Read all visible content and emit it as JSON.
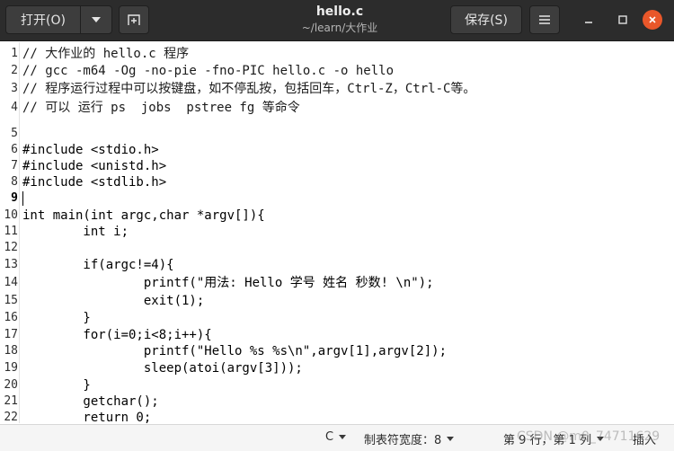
{
  "header": {
    "open_label": "打开(O)",
    "save_label": "保存(S)",
    "title": "hello.c",
    "subtitle": "~/learn/大作业"
  },
  "editor": {
    "current_line": 9,
    "lines": [
      {
        "n": "1",
        "text": "// 大作业的 hello.c 程序"
      },
      {
        "n": "2",
        "text": "// gcc -m64 -Og -no-pie -fno-PIC hello.c -o hello"
      },
      {
        "n": "3",
        "text": "// 程序运行过程中可以按键盘，如不停乱按，包括回车，Ctrl-Z，Ctrl-C等。"
      },
      {
        "n": "4",
        "text": "// 可以 运行 ps  jobs  pstree fg 等命令"
      },
      {
        "n": "5",
        "text": ""
      },
      {
        "n": "6",
        "text": "#include <stdio.h>"
      },
      {
        "n": "7",
        "text": "#include <unistd.h>"
      },
      {
        "n": "8",
        "text": "#include <stdlib.h>"
      },
      {
        "n": "9",
        "text": ""
      },
      {
        "n": "10",
        "text": "int main(int argc,char *argv[]){"
      },
      {
        "n": "11",
        "text": "        int i;"
      },
      {
        "n": "12",
        "text": ""
      },
      {
        "n": "13",
        "text": "        if(argc!=4){"
      },
      {
        "n": "14",
        "text": "                printf(\"用法: Hello 学号 姓名 秒数! \\n\");"
      },
      {
        "n": "15",
        "text": "                exit(1);"
      },
      {
        "n": "16",
        "text": "        }"
      },
      {
        "n": "17",
        "text": "        for(i=0;i<8;i++){"
      },
      {
        "n": "18",
        "text": "                printf(\"Hello %s %s\\n\",argv[1],argv[2]);"
      },
      {
        "n": "19",
        "text": "                sleep(atoi(argv[3]));"
      },
      {
        "n": "20",
        "text": "        }"
      },
      {
        "n": "21",
        "text": "        getchar();"
      },
      {
        "n": "22",
        "text": "        return 0;"
      }
    ]
  },
  "statusbar": {
    "language": "C",
    "tab_width": "制表符宽度：8",
    "position": "第 9 行，第 1 列",
    "mode": "插入",
    "watermark": "CSDN @m0_74711629"
  }
}
